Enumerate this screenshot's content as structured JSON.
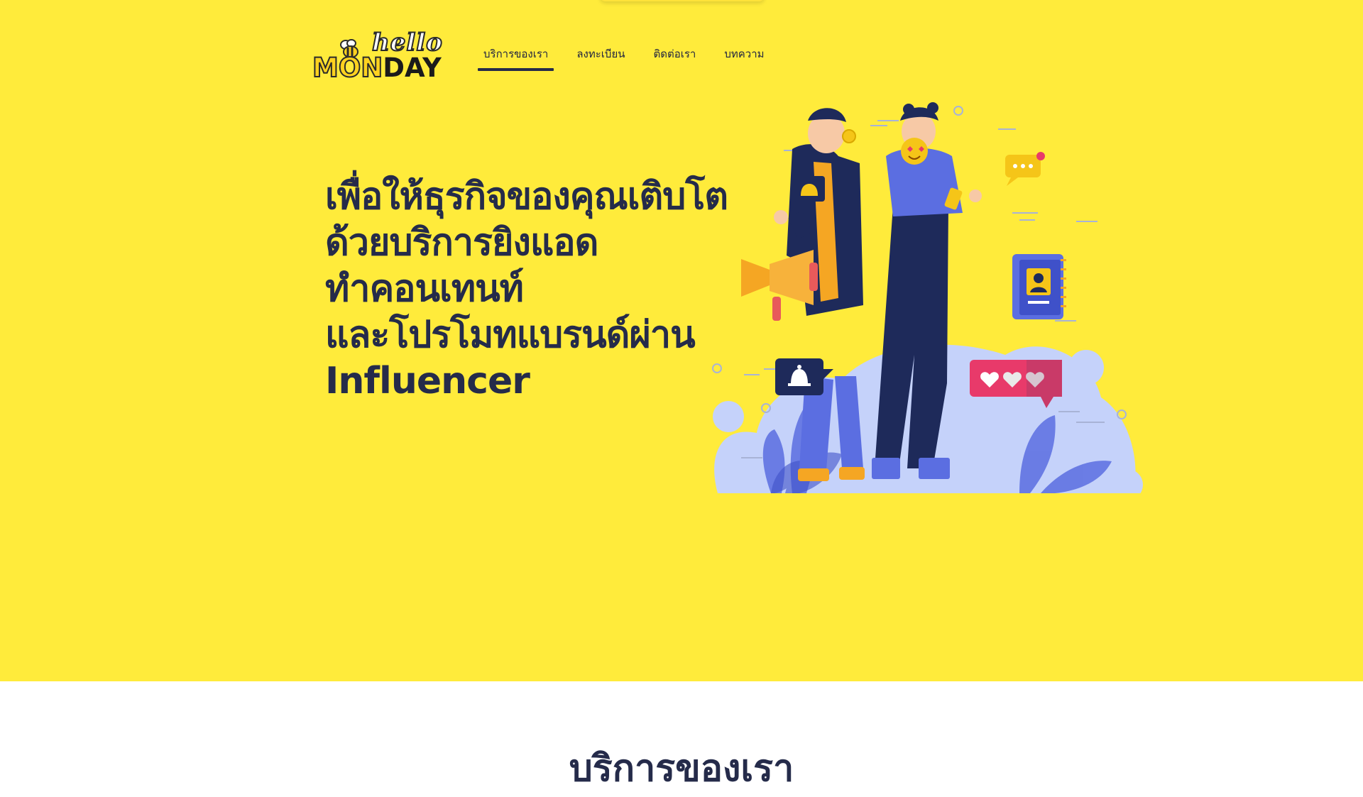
{
  "header": {
    "logo_hello": "hello",
    "logo_mon": "MON",
    "logo_day": "DAY",
    "nav": [
      {
        "label": "บริการของเรา",
        "active": true
      },
      {
        "label": "ลงทะเบียน",
        "active": false
      },
      {
        "label": "ติดต่อเรา",
        "active": false
      },
      {
        "label": "บทความ",
        "active": false
      }
    ]
  },
  "hero": {
    "lines": [
      "เพื่อให้ธุรกิจของคุณเติบโต",
      "ด้วยบริการยิงแอด",
      "ทำคอนเทนท์",
      "และโปรโมทแบรนด์ผ่าน",
      "Influencer"
    ]
  },
  "services": {
    "title": "บริการของเรา"
  },
  "colors": {
    "hero_bg": "#FFEB3B",
    "text_dark": "#252b4a",
    "accent_blue": "#5B6EE1",
    "accent_pink": "#E83A6A"
  },
  "icons": [
    "bee-icon",
    "megaphone-icon",
    "bell-icon",
    "hearts-icon",
    "chat-icon",
    "contact-book-icon",
    "emoji-icon"
  ]
}
